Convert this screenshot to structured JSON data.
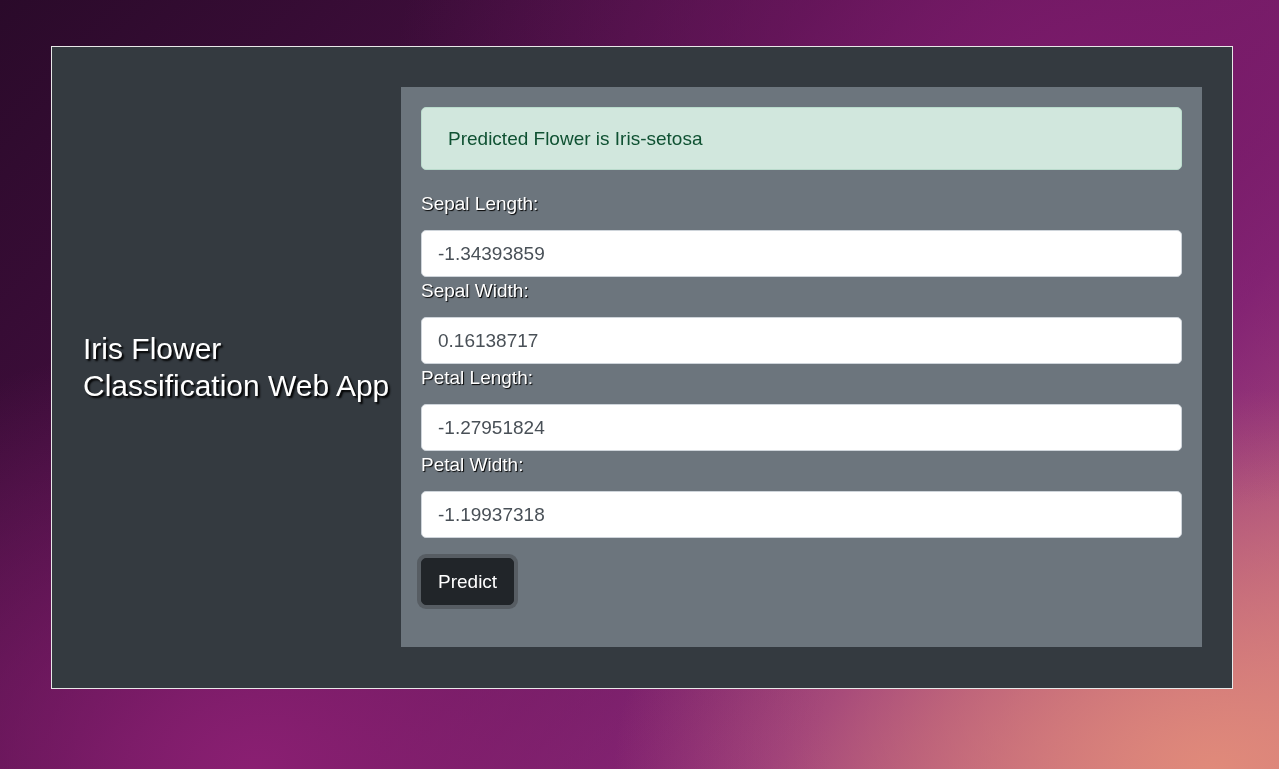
{
  "app_title": "Iris Flower Classification Web App",
  "prediction_alert": "Predicted Flower is Iris-setosa",
  "fields": [
    {
      "label": "Sepal Length:",
      "value": "-1.34393859"
    },
    {
      "label": "Sepal Width:",
      "value": "0.16138717"
    },
    {
      "label": "Petal Length:",
      "value": "-1.27951824"
    },
    {
      "label": "Petal Width:",
      "value": "-1.19937318"
    }
  ],
  "submit_button": "Predict"
}
